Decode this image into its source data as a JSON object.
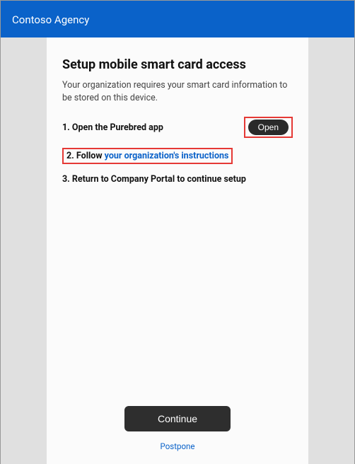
{
  "topbar": {
    "org_name": "Contoso Agency"
  },
  "page": {
    "title": "Setup mobile smart card access",
    "subtitle": "Your organization requires your smart card information to be stored on this device.",
    "steps": {
      "one_prefix": "1.  Open the Purebred app",
      "open_button": "Open",
      "two_prefix": "2.  Follow ",
      "two_link": "your organization's instructions",
      "three": "3.  Return to Company Portal to continue setup"
    },
    "continue_button": "Continue",
    "postpone_link": "Postpone"
  }
}
